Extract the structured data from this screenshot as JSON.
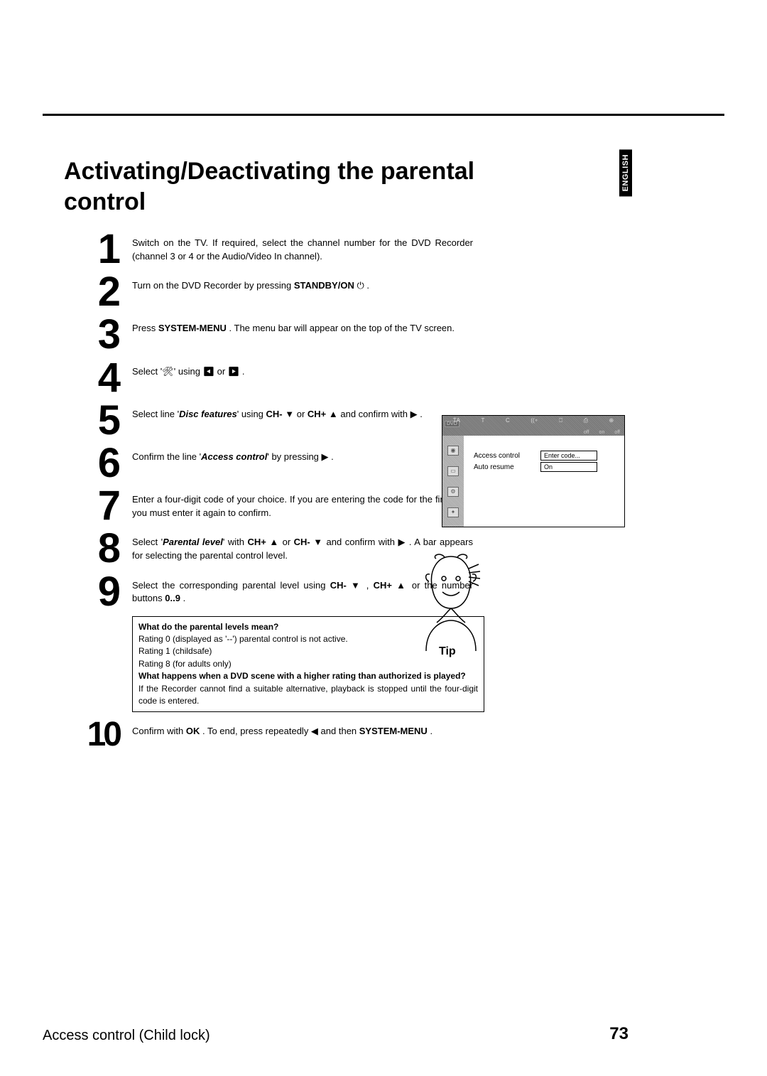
{
  "lang_tab": "ENGLISH",
  "title": "Activating/Deactivating the parental control",
  "steps": {
    "s1": "Switch on the TV. If required, select the channel number for the DVD Recorder (channel 3 or 4 or the Audio/Video In channel).",
    "s2_a": "Turn on the DVD Recorder by pressing ",
    "s2_b": "STANDBY/ON",
    "s2_c": " ⏻ .",
    "s3_a": "Press ",
    "s3_b": "SYSTEM-MENU",
    "s3_c": " . The menu bar will appear on the top of the TV screen.",
    "s4_a": "Select '",
    "s4_icon": "🔧",
    "s4_b": "' using  ◀  or  ▶ .",
    "s5_a": "Select line '",
    "s5_b": "Disc features",
    "s5_c": "' using ",
    "s5_d": "CH-",
    "s5_e": " ▼ or ",
    "s5_f": "CH+",
    "s5_g": " ▲ and confirm with ▶ .",
    "s6_a": "Confirm the line '",
    "s6_b": "Access control",
    "s6_c": "' by pressing ▶ .",
    "s7": "Enter a four-digit code of your choice. If you are entering the code for the first time, you must enter it again to confirm.",
    "s8_a": "Select '",
    "s8_b": "Parental level",
    "s8_c": "' with ",
    "s8_d": "CH+",
    "s8_e": " ▲ or ",
    "s8_f": "CH-",
    "s8_g": " ▼ and confirm with ▶ . A bar appears for selecting the parental control level.",
    "s9_a": "Select the corresponding parental level using ",
    "s9_b": "CH-",
    "s9_c": " ▼ , ",
    "s9_d": "CH+",
    "s9_e": " ▲ or the number buttons ",
    "s9_f": "0..9",
    "s9_g": " .",
    "s10_a": "Confirm with ",
    "s10_b": "OK",
    "s10_c": " . To end, press repeatedly ◀ and then ",
    "s10_d": "SYSTEM-MENU",
    "s10_e": " ."
  },
  "tip": {
    "q1": "What do the parental levels mean?",
    "l1": "Rating 0 (displayed as '--') parental control is not active.",
    "l2": "Rating 1 (childsafe)",
    "l3": "Rating 8 (for adults only)",
    "q2": "What happens when a DVD scene with a higher rating than authorized is played?",
    "l4": "If the Recorder cannot find a suitable alternative, playback is stopped until the four-digit code is entered.",
    "label": "Tip"
  },
  "osd": {
    "dvd": "DVD",
    "top_icons": [
      "ṪA",
      "T",
      "C",
      "((∘",
      "⎕",
      "⎙",
      "⊕"
    ],
    "top_row2": [
      "off",
      "on",
      "off"
    ],
    "rows": [
      {
        "label": "Access control",
        "value": "Enter code..."
      },
      {
        "label": "Auto resume",
        "value": "On"
      }
    ]
  },
  "footer": {
    "left": "Access control (Child lock)",
    "right": "73"
  }
}
